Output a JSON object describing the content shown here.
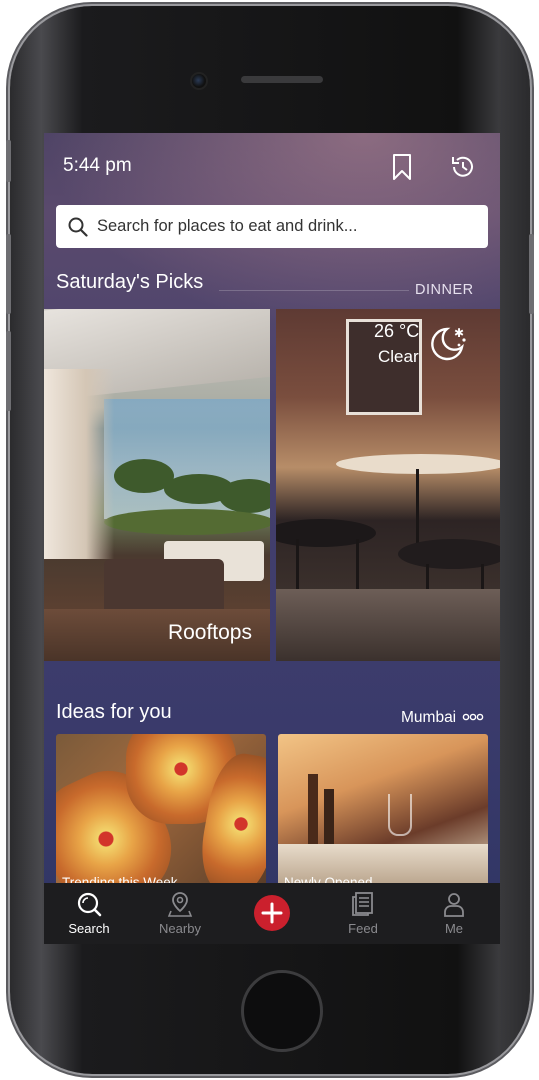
{
  "status": {
    "time": "5:44 pm"
  },
  "header": {
    "bookmark_icon": "bookmark-icon",
    "history_icon": "history-icon"
  },
  "search": {
    "placeholder": "Search for places to eat and drink..."
  },
  "picks": {
    "title": "Saturday's Picks",
    "meal": "DINNER",
    "cards": [
      {
        "label": "Rooftops"
      }
    ]
  },
  "weather": {
    "temperature": "26 °C",
    "condition": "Clear",
    "icon": "moon-stars-icon"
  },
  "ideas": {
    "title": "Ideas for you",
    "city": "Mumbai",
    "cards": [
      {
        "label": "Trending this Week"
      },
      {
        "label": "Newly Opened"
      }
    ]
  },
  "tabs": [
    {
      "label": "Search",
      "icon": "search-icon",
      "active": true
    },
    {
      "label": "Nearby",
      "icon": "map-pin-icon",
      "active": false
    },
    {
      "label": "",
      "icon": "plus-icon",
      "active": false
    },
    {
      "label": "Feed",
      "icon": "feed-icon",
      "active": false
    },
    {
      "label": "Me",
      "icon": "user-icon",
      "active": false
    }
  ],
  "colors": {
    "accent": "#cb202d",
    "tabbar": "#1d1d1f"
  }
}
